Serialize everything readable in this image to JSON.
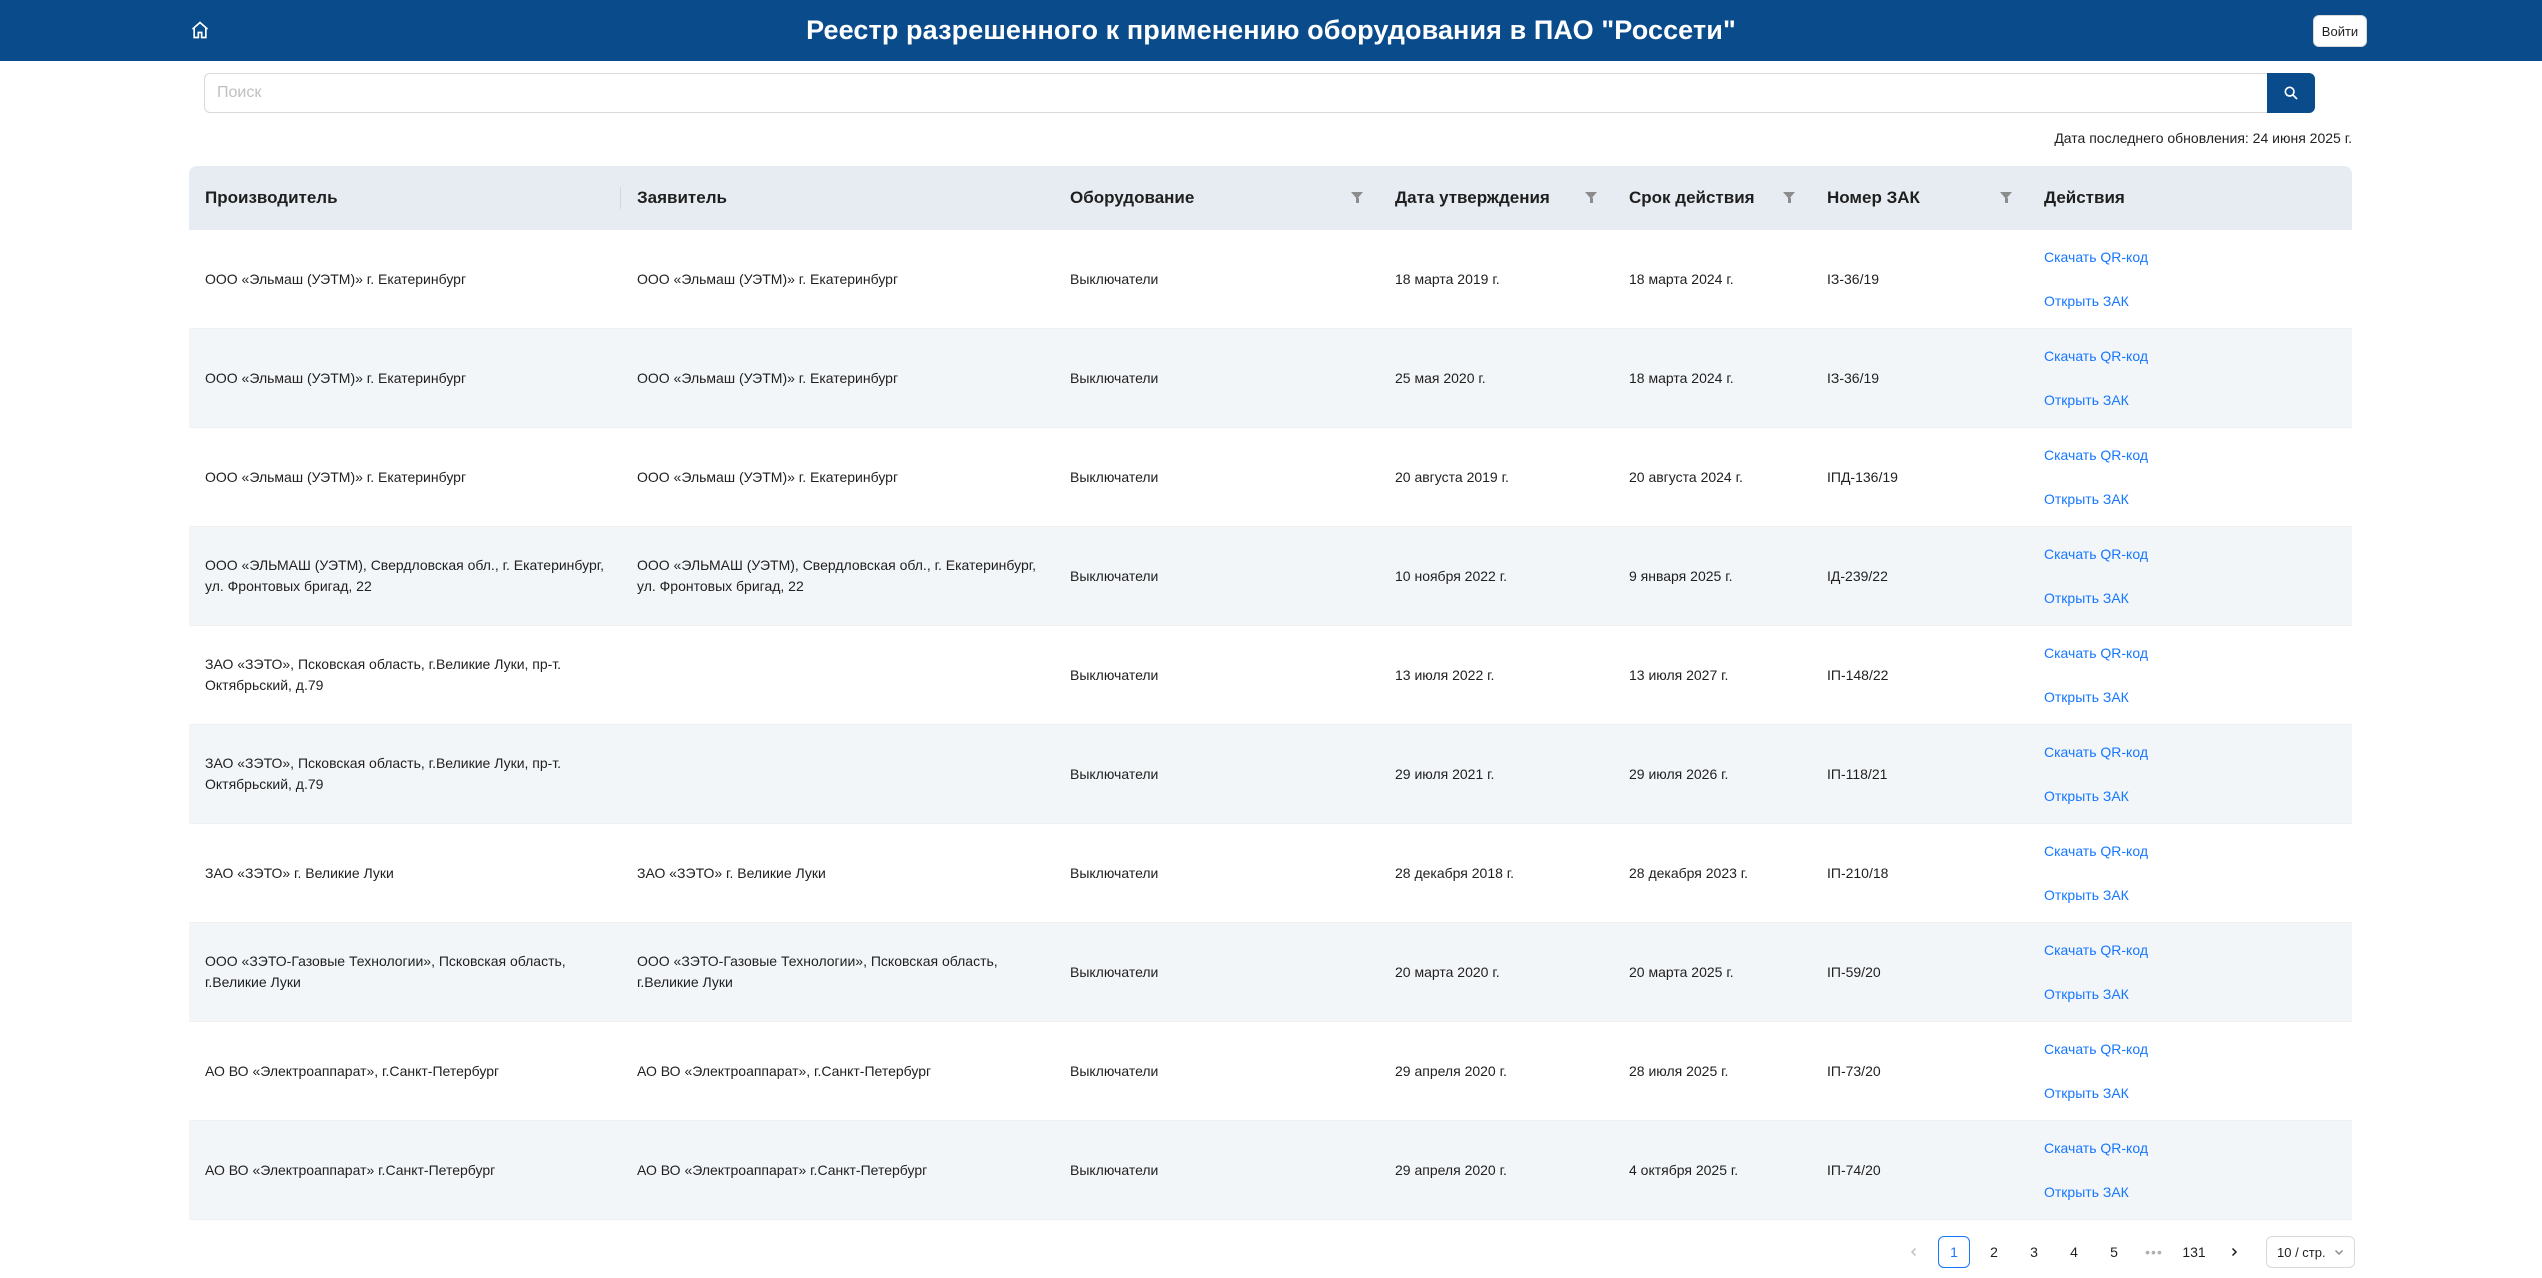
{
  "header": {
    "title": "Реестр разрешенного к применению оборудования в ПАО \"Россети\"",
    "login_label": "Войти",
    "home_icon": "home-icon"
  },
  "search": {
    "placeholder": "Поиск",
    "value": "",
    "button_icon": "search-icon"
  },
  "update_date": "Дата последнего обновления: 24 июня 2025 г.",
  "table": {
    "columns": [
      "Производитель",
      "Заявитель",
      "Оборудование",
      "Дата утверждения",
      "Срок действия",
      "Номер ЗАК",
      "Действия"
    ],
    "action_labels": {
      "qr": "Скачать QR-код",
      "open": "Открыть ЗАК"
    },
    "rows": [
      [
        "ООО «Эльмаш (УЭТМ)» г. Екатеринбург",
        "ООО «Эльмаш (УЭТМ)» г. Екатеринбург",
        "Выключатели",
        "18 марта 2019 г.",
        "18 марта 2024 г.",
        "IЗ-36/19"
      ],
      [
        "ООО «Эльмаш (УЭТМ)» г. Екатеринбург",
        "ООО «Эльмаш (УЭТМ)» г. Екатеринбург",
        "Выключатели",
        "25 мая 2020 г.",
        "18 марта 2024 г.",
        "IЗ-36/19"
      ],
      [
        "ООО «Эльмаш (УЭТМ)» г. Екатеринбург",
        "ООО «Эльмаш (УЭТМ)» г. Екатеринбург",
        "Выключатели",
        "20 августа 2019 г.",
        "20 августа 2024 г.",
        "IПД-136/19"
      ],
      [
        "ООО «ЭЛЬМАШ (УЭТМ), Свердловская обл., г. Екатеринбург, ул. Фронтовых бригад, 22",
        "ООО «ЭЛЬМАШ (УЭТМ), Свердловская обл., г. Екатеринбург, ул. Фронтовых бригад, 22",
        "Выключатели",
        "10 ноября 2022 г.",
        "9 января 2025 г.",
        "IД-239/22"
      ],
      [
        "ЗАО «ЗЭТО», Псковская область, г.Великие Луки, пр-т. Октябрьский, д.79",
        "",
        "Выключатели",
        "13 июля 2022 г.",
        "13 июля 2027 г.",
        "IП-148/22"
      ],
      [
        "ЗАО «ЗЭТО», Псковская область, г.Великие Луки, пр-т. Октябрьский, д.79",
        "",
        "Выключатели",
        "29 июля 2021 г.",
        "29 июля 2026 г.",
        "IП-118/21"
      ],
      [
        "ЗАО «ЗЭТО» г. Великие Луки",
        "ЗАО «ЗЭТО» г. Великие Луки",
        "Выключатели",
        "28 декабря 2018 г.",
        "28 декабря 2023 г.",
        "IП-210/18"
      ],
      [
        "ООО «ЗЭТО-Газовые Технологии», Псковская область, г.Великие Луки",
        "ООО «ЗЭТО-Газовые Технологии», Псковская область, г.Великие Луки",
        "Выключатели",
        "20 марта 2020 г.",
        "20 марта 2025 г.",
        "IП-59/20"
      ],
      [
        "АО ВО «Электроаппарат», г.Санкт-Петербург",
        "АО ВО «Электроаппарат», г.Санкт-Петербург",
        "Выключатели",
        "29 апреля 2020 г.",
        "28 июля 2025 г.",
        "IП-73/20"
      ],
      [
        "АО ВО «Электроаппарат» г.Санкт-Петербург",
        "АО ВО «Электроаппарат» г.Санкт-Петербург",
        "Выключатели",
        "29 апреля 2020 г.",
        "4 октября 2025 г.",
        "IП-74/20"
      ]
    ]
  },
  "pagination": {
    "pages": [
      "1",
      "2",
      "3",
      "4",
      "5"
    ],
    "current": "1",
    "ellipsis": "•••",
    "last": "131",
    "page_size": "10 / стр."
  },
  "colors": {
    "brand": "#0a4b8c",
    "link": "#1677ff",
    "header_row": "#e6ecf2",
    "alt_row": "#f3f6f9"
  }
}
